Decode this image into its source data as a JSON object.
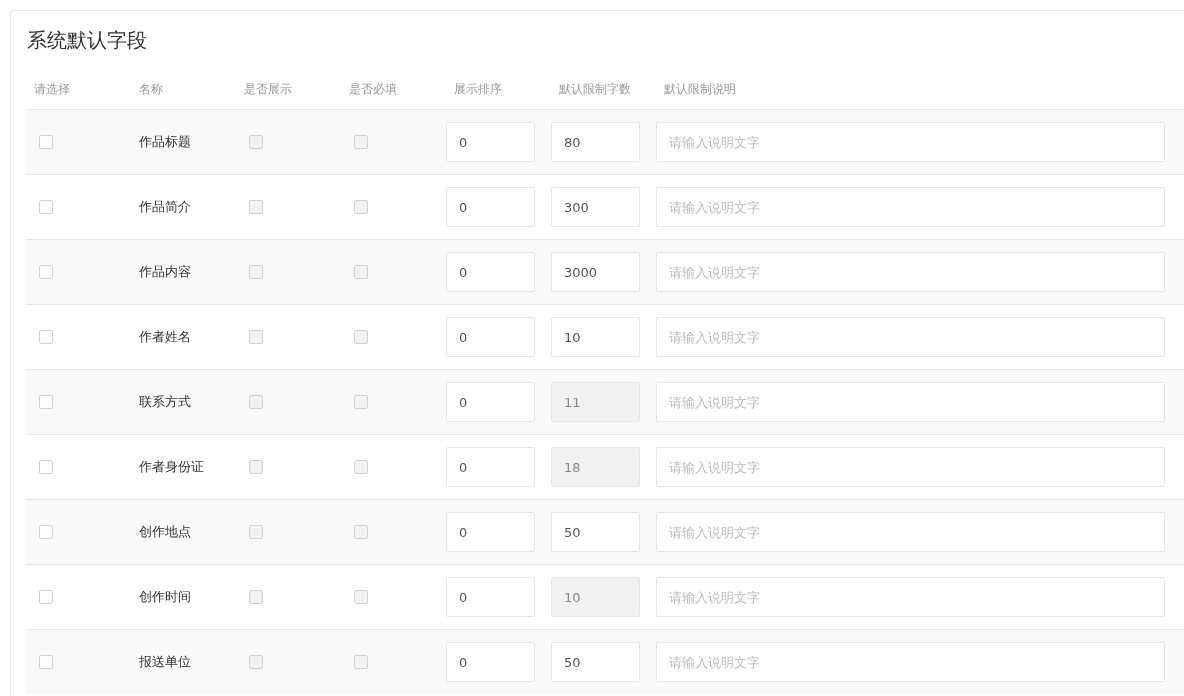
{
  "title": "系统默认字段",
  "columns": [
    "请选择",
    "名称",
    "是否展示",
    "是否必填",
    "展示排序",
    "默认限制字数",
    "默认限制说明"
  ],
  "rows": [
    {
      "select": {
        "checked": false
      },
      "name": "作品标题",
      "show": {
        "checked": false,
        "disabled": true
      },
      "required": {
        "checked": false,
        "disabled": true
      },
      "sort": "0",
      "limit": {
        "value": "80",
        "disabled": false
      },
      "note": {
        "placeholder": "请输入说明文字"
      }
    },
    {
      "select": {
        "checked": false
      },
      "name": "作品简介",
      "show": {
        "checked": false,
        "disabled": true
      },
      "required": {
        "checked": false,
        "disabled": true
      },
      "sort": "0",
      "limit": {
        "value": "300",
        "disabled": false
      },
      "note": {
        "placeholder": "请输入说明文字"
      }
    },
    {
      "select": {
        "checked": false
      },
      "name": "作品内容",
      "show": {
        "checked": false,
        "disabled": true
      },
      "required": {
        "checked": false,
        "disabled": true
      },
      "sort": "0",
      "limit": {
        "value": "3000",
        "disabled": false
      },
      "note": {
        "placeholder": "请输入说明文字"
      }
    },
    {
      "select": {
        "checked": false
      },
      "name": "作者姓名",
      "show": {
        "checked": false,
        "disabled": true
      },
      "required": {
        "checked": false,
        "disabled": true
      },
      "sort": "0",
      "limit": {
        "value": "10",
        "disabled": false
      },
      "note": {
        "placeholder": "请输入说明文字"
      }
    },
    {
      "select": {
        "checked": false
      },
      "name": "联系方式",
      "show": {
        "checked": false,
        "disabled": true
      },
      "required": {
        "checked": false,
        "disabled": true
      },
      "sort": "0",
      "limit": {
        "value": "11",
        "disabled": true
      },
      "note": {
        "placeholder": "请输入说明文字"
      }
    },
    {
      "select": {
        "checked": false
      },
      "name": "作者身份证",
      "show": {
        "checked": false,
        "disabled": true
      },
      "required": {
        "checked": false,
        "disabled": true
      },
      "sort": "0",
      "limit": {
        "value": "18",
        "disabled": true
      },
      "note": {
        "placeholder": "请输入说明文字"
      }
    },
    {
      "select": {
        "checked": false
      },
      "name": "创作地点",
      "show": {
        "checked": false,
        "disabled": true
      },
      "required": {
        "checked": false,
        "disabled": true
      },
      "sort": "0",
      "limit": {
        "value": "50",
        "disabled": false
      },
      "note": {
        "placeholder": "请输入说明文字"
      }
    },
    {
      "select": {
        "checked": false
      },
      "name": "创作时间",
      "show": {
        "checked": false,
        "disabled": true
      },
      "required": {
        "checked": false,
        "disabled": true
      },
      "sort": "0",
      "limit": {
        "value": "10",
        "disabled": true
      },
      "note": {
        "placeholder": "请输入说明文字"
      }
    },
    {
      "select": {
        "checked": false
      },
      "name": "报送单位",
      "show": {
        "checked": false,
        "disabled": true
      },
      "required": {
        "checked": false,
        "disabled": true
      },
      "sort": "0",
      "limit": {
        "value": "50",
        "disabled": false
      },
      "note": {
        "placeholder": "请输入说明文字"
      }
    }
  ]
}
